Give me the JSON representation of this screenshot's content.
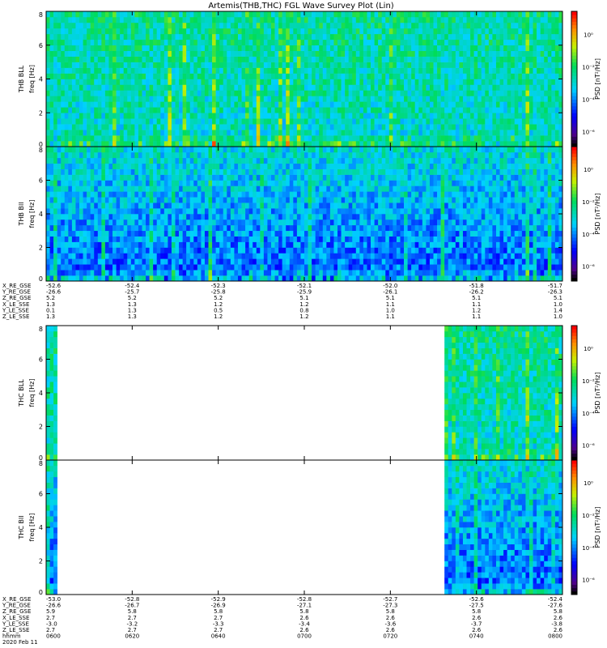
{
  "title": "Artemis(THB,THC) FGL Wave Survey Plot (Lin)",
  "colors": {
    "background": "#ffffff",
    "axis": "#000000",
    "empty_panel": "#ffffff"
  },
  "chart_data": {
    "type": "heatmap",
    "colorbar": {
      "label": "PSD [nT²/Hz]",
      "colormap": "rainbow (black - violet - blue - cyan - green - yellow - red)",
      "ticks": [
        "10⁰",
        "10⁻²",
        "10⁻⁴",
        "10⁻⁶"
      ]
    },
    "panel_groups": [
      {
        "probe": "THB",
        "panels": [
          {
            "name": "THB BLL",
            "ylabel_top": "THB BLL",
            "ylabel_bottom": "freq [Hz]",
            "ylim": [
              0,
              8
            ],
            "yticks": [
              "0",
              "2",
              "4",
              "6",
              "8"
            ],
            "data_start_fraction": 0.0,
            "data_end_fraction": 1.0,
            "style": "parallel"
          },
          {
            "name": "THB Bll",
            "ylabel_top": "THB Bll",
            "ylabel_bottom": "freq [Hz]",
            "ylim": [
              0,
              8
            ],
            "yticks": [
              "0",
              "2",
              "4",
              "6",
              "8"
            ],
            "data_start_fraction": 0.0,
            "data_end_fraction": 1.0,
            "style": "perpendicular"
          }
        ],
        "ephemeris": {
          "labels": [
            "X_RE_GSE",
            "Y_RE_GSE",
            "Z_RE_GSE",
            "X_LE_SSE",
            "Y_LE_SSE",
            "Z_LE_SSE"
          ],
          "columns": [
            [
              "-52.6",
              "-26.6",
              "5.2",
              "1.3",
              "0.1",
              "1.3"
            ],
            [
              "-52.4",
              "-25.7",
              "5.2",
              "1.3",
              "1.3",
              "1.3"
            ],
            [
              "-52.3",
              "-25.8",
              "5.2",
              "1.2",
              "0.5",
              "1.2"
            ],
            [
              "-52.1",
              "-25.9",
              "5.1",
              "1.2",
              "0.8",
              "1.2"
            ],
            [
              "-52.0",
              "-26.1",
              "5.1",
              "1.1",
              "1.0",
              "1.1"
            ],
            [
              "-51.8",
              "-26.2",
              "5.1",
              "1.1",
              "1.2",
              "1.1"
            ],
            [
              "-51.7",
              "-26.3",
              "5.1",
              "1.0",
              "1.4",
              "1.0"
            ]
          ]
        }
      },
      {
        "probe": "THC",
        "panels": [
          {
            "name": "THC BLL",
            "ylabel_top": "THC BLL",
            "ylabel_bottom": "freq [Hz]",
            "ylim": [
              0,
              8
            ],
            "yticks": [
              "0",
              "2",
              "4",
              "6",
              "8"
            ],
            "data_segments": [
              [
                0.0,
                0.02
              ],
              [
                0.765,
                1.0
              ]
            ],
            "style": "parallel"
          },
          {
            "name": "THC Bll",
            "ylabel_top": "THC Bll",
            "ylabel_bottom": "freq [Hz]",
            "ylim": [
              0,
              8
            ],
            "yticks": [
              "0",
              "2",
              "4",
              "6",
              "8"
            ],
            "data_segments": [
              [
                0.0,
                0.02
              ],
              [
                0.765,
                1.0
              ]
            ],
            "style": "perpendicular"
          }
        ],
        "ephemeris": {
          "labels": [
            "X_RE_GSE",
            "Y_RE_GSE",
            "Z_RE_GSE",
            "X_LE_SSE",
            "Y_LE_SSE",
            "Z_LE_SSE"
          ],
          "columns": [
            [
              "-53.0",
              "-26.6",
              "5.9",
              "2.7",
              "-3.0",
              "2.7"
            ],
            [
              "-52.8",
              "-26.7",
              "5.8",
              "2.7",
              "-3.2",
              "2.7"
            ],
            [
              "-52.9",
              "-26.9",
              "5.8",
              "2.7",
              "-3.3",
              "2.7"
            ],
            [
              "-52.8",
              "-27.1",
              "5.8",
              "2.6",
              "-3.4",
              "2.6"
            ],
            [
              "-52.7",
              "-27.3",
              "5.8",
              "2.6",
              "-3.6",
              "2.6"
            ],
            [
              "-52.6",
              "-27.5",
              "5.8",
              "2.6",
              "-3.7",
              "2.6"
            ],
            [
              "-52.4",
              "-27.6",
              "5.8",
              "2.6",
              "-3.8",
              "2.6"
            ]
          ]
        },
        "time_axis": {
          "label": "hhmm",
          "ticks": [
            "0600",
            "0620",
            "0640",
            "0700",
            "0720",
            "0740",
            "0800"
          ],
          "date": "2020 Feb 11"
        }
      }
    ]
  }
}
